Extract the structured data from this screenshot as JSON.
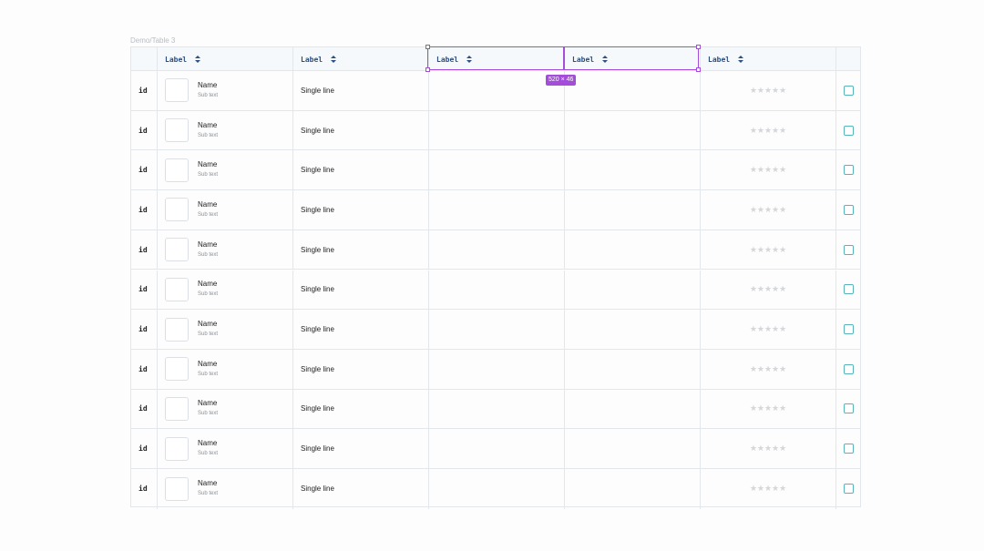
{
  "frame": {
    "label": "Demo/Table 3"
  },
  "header": {
    "columns": [
      "Label",
      "Label",
      "Label",
      "Label",
      "Label"
    ]
  },
  "rows": [
    {
      "id": "id",
      "name": "Name",
      "subtext": "Sub text",
      "text": "Single line",
      "rating": "★★★★★",
      "checked": false
    },
    {
      "id": "id",
      "name": "Name",
      "subtext": "Sub text",
      "text": "Single line",
      "rating": "★★★★★",
      "checked": false
    },
    {
      "id": "id",
      "name": "Name",
      "subtext": "Sub text",
      "text": "Single line",
      "rating": "★★★★★",
      "checked": false
    },
    {
      "id": "id",
      "name": "Name",
      "subtext": "Sub text",
      "text": "Single line",
      "rating": "★★★★★",
      "checked": false
    },
    {
      "id": "id",
      "name": "Name",
      "subtext": "Sub text",
      "text": "Single line",
      "rating": "★★★★★",
      "checked": false
    },
    {
      "id": "id",
      "name": "Name",
      "subtext": "Sub text",
      "text": "Single line",
      "rating": "★★★★★",
      "checked": false
    },
    {
      "id": "id",
      "name": "Name",
      "subtext": "Sub text",
      "text": "Single line",
      "rating": "★★★★★",
      "checked": false
    },
    {
      "id": "id",
      "name": "Name",
      "subtext": "Sub text",
      "text": "Single line",
      "rating": "★★★★★",
      "checked": false
    },
    {
      "id": "id",
      "name": "Name",
      "subtext": "Sub text",
      "text": "Single line",
      "rating": "★★★★★",
      "checked": false
    },
    {
      "id": "id",
      "name": "Name",
      "subtext": "Sub text",
      "text": "Single line",
      "rating": "★★★★★",
      "checked": false
    },
    {
      "id": "id",
      "name": "Name",
      "subtext": "Sub text",
      "text": "Single line",
      "rating": "★★★★★",
      "checked": false
    }
  ],
  "selection": {
    "size_label": "520 × 46"
  },
  "colors": {
    "selection": "#a44ddb",
    "header_text": "#2b4f82",
    "checkbox_border": "#58b4b8",
    "grid_line": "#e3e6ea"
  },
  "icons": {
    "sort": "sort-icon",
    "star": "star-icon"
  }
}
